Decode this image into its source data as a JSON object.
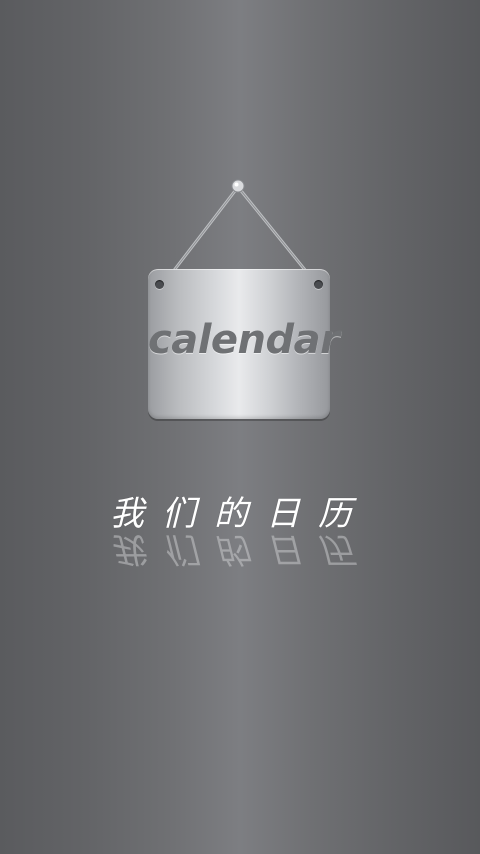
{
  "splash": {
    "sign_label": "calendar",
    "title": "我们的日历"
  },
  "icons": {
    "nail": "nail-icon",
    "sign": "hanging-sign-icon"
  },
  "colors": {
    "background": "#6f7073",
    "sign_metal": "#e9eaec",
    "sign_text": "#6f7174",
    "title_text": "#ffffff"
  }
}
